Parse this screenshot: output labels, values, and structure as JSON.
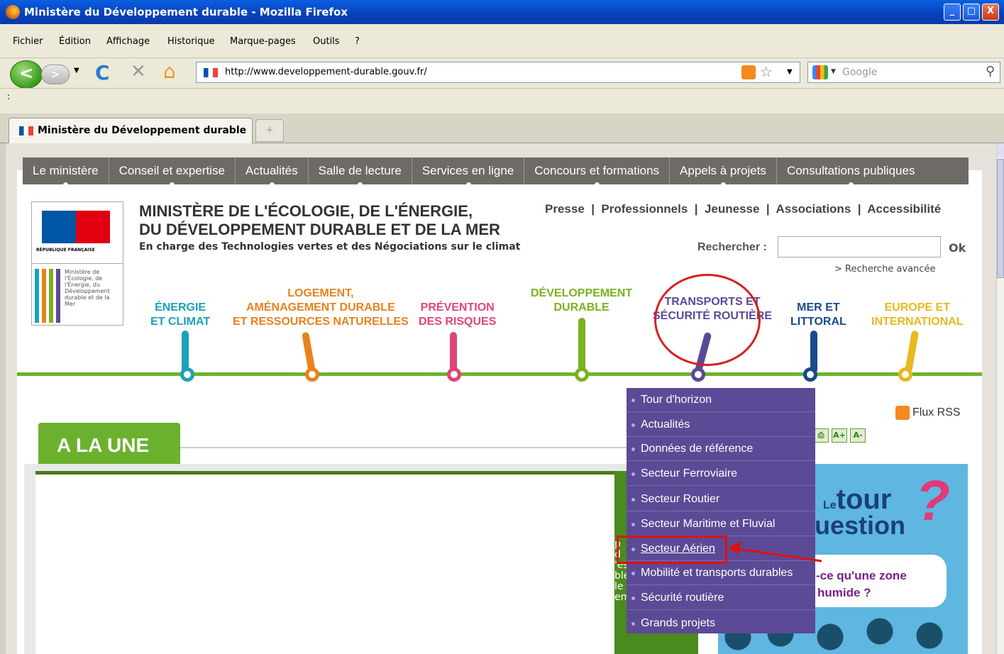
{
  "window": {
    "title": "Ministère du Développement durable - Mozilla Firefox",
    "min": "_",
    "max": "□",
    "close": "X"
  },
  "menu": [
    "Fichier",
    "Édition",
    "Affichage",
    "Historique",
    "Marque-pages",
    "Outils",
    "?"
  ],
  "nav": {
    "back": "<",
    "forward": ">",
    "reload": "C",
    "stop": "✕",
    "home": "⌂",
    "url": "http://www.developpement-durable.gouv.fr/",
    "search_placeholder": "Google",
    "bookmark_star": "☆"
  },
  "tab": {
    "label": "Ministère du Développement durable",
    "new_tab": "+"
  },
  "site": {
    "topnav": [
      "Le ministère",
      "Conseil et expertise",
      "Actualités",
      "Salle de lecture",
      "Services en ligne",
      "Concours et formations",
      "Appels à projets",
      "Consultations publiques"
    ],
    "logo_text": "Ministère de l'Écologie, de l'Énergie, du Développement durable et de la Mer",
    "republique": "RÉPUBLIQUE FRANÇAISE",
    "title_line1": "MINISTÈRE DE L'ÉCOLOGIE, DE L'ÉNERGIE,",
    "title_line2": "DU DÉVELOPPEMENT DURABLE ET DE LA MER",
    "subtitle": "En charge des Technologies vertes et des Négociations sur le climat",
    "toplinks": "Presse  |  Professionnels  |  Jeunesse  |  Associations  |  Accessibilité",
    "search_label": "Rechercher :",
    "ok": "Ok",
    "advanced": "> Recherche avancée",
    "themes": [
      {
        "l1": "ÉNERGIE",
        "l2": "ET CLIMAT",
        "color": "#1aa3b8"
      },
      {
        "l1": "LOGEMENT,",
        "l2": "AMÉNAGEMENT DURABLE",
        "l3": "ET RESSOURCES NATURELLES",
        "color": "#e8821e"
      },
      {
        "l1": "PRÉVENTION",
        "l2": "DES RISQUES",
        "color": "#e0457a"
      },
      {
        "l1": "DÉVELOPPEMENT",
        "l2": "DURABLE",
        "color": "#7ab21e"
      },
      {
        "l1": "TRANSPORTS ET",
        "l2": "SÉCURITÉ ROUTIÈRE",
        "color": "#5c4a96"
      },
      {
        "l1": "MER ET",
        "l2": "LITTORAL",
        "color": "#1a4a8a"
      },
      {
        "l1": "EUROPE ET",
        "l2": "INTERNATIONAL",
        "color": "#e8b81e"
      }
    ],
    "une": "A LA UNE",
    "flux": "Flux RSS",
    "tools": [
      "⎙",
      "A+",
      "A-"
    ],
    "tour_le": "Le",
    "tour": "tour",
    "question": "uestion",
    "qmark": "?",
    "bubble_l1": "-ce qu'une zone",
    "bubble_l2": "humide ?",
    "partial": "p\nd\n'es\nble\nle\nem",
    "dropdown": [
      "Tour d'horizon",
      "Actualités",
      "Données de référence",
      "Secteur Ferroviaire",
      "Secteur Routier",
      "Secteur Maritime et Fluvial",
      "Secteur Aérien",
      "Mobilité et transports durables",
      "Sécurité routière",
      "Grands projets"
    ]
  }
}
